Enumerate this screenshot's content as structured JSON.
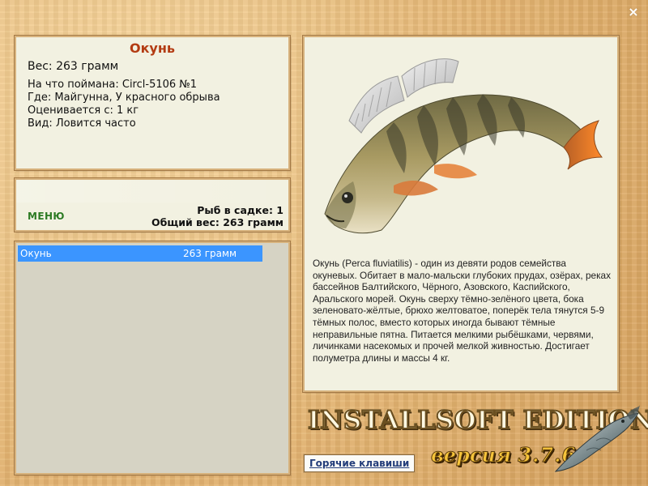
{
  "window": {
    "close_icon": "×"
  },
  "info": {
    "title": "Окунь",
    "weight_line": "Вес: 263 грамм",
    "caught_with_line": "На что поймана: Circl-5106 №1",
    "where_line": "Где: Майгунна, У красного обрыва",
    "evaluated_line": "Оценивается с: 1 кг",
    "kind_line": "Вид: Ловится часто"
  },
  "menu_panel": {
    "menu_label": "МЕНЮ",
    "fish_in_keepnet": "Рыб в садке: 1",
    "total_weight": "Общий вес: 263 грамм"
  },
  "fish_list": {
    "items": [
      {
        "name": "Окунь",
        "weight": "263 грамм",
        "selected": true
      }
    ],
    "selected_color": "#3b95ff"
  },
  "description": {
    "text": "Окунь (Perca fluviatilis) - один из девяти родов семейства окуневых. Обитает в мало-мальски глубоких прудах, озёрах, реках бассейнов Балтийского, Чёрного, Азовского, Каспийского, Аральского морей. Окунь сверху тёмно-зелёного цвета, бока зеленовато-жёлтые, брюхо желтоватое, поперёк тела тянутся 5-9 тёмных полос, вместо которых иногда бывают тёмные неправильные пятна. Питается мелкими рыбёшками, червями, личинками насекомых и прочей мелкой живностью. Достигает полуметра длины и массы 4 кг."
  },
  "branding": {
    "edition": "INSTALLSOFT EDITION",
    "version_label": "версия",
    "version_number": "3.7.6"
  },
  "hotkeys": {
    "label": "Горячие клавиши"
  },
  "icons": {
    "fish_image": "perch-image",
    "logo_fish": "sturgeon-icon"
  }
}
